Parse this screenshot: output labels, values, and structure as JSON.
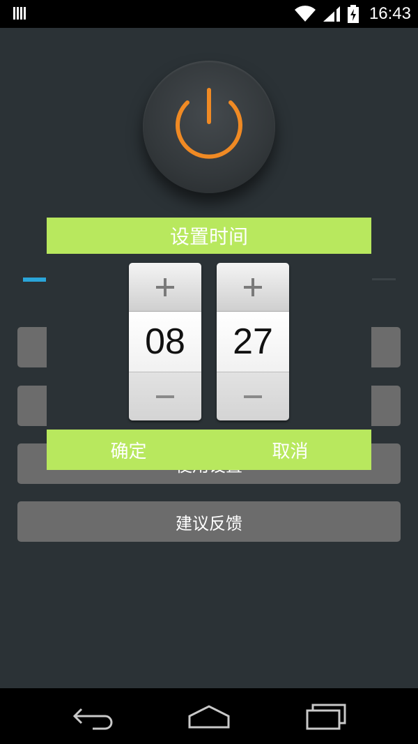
{
  "status_bar": {
    "time": "16:43",
    "icons": [
      "signal-bars-icon",
      "wifi-icon",
      "cellular-icon",
      "battery-charging-icon"
    ]
  },
  "main": {
    "power_button_icon": "power-icon",
    "menu_buttons": [
      "",
      "",
      "使用设置",
      "建议反馈"
    ]
  },
  "dialog": {
    "title": "设置时间",
    "hour": "08",
    "minute": "27",
    "increment_icon": "plus-icon",
    "decrement_icon": "minus-icon",
    "confirm_label": "确定",
    "cancel_label": "取消"
  },
  "nav_bar": {
    "icons": [
      "back-icon",
      "home-icon",
      "recents-icon"
    ]
  },
  "colors": {
    "accent_green": "#b8e85e",
    "power_orange": "#f08a24",
    "tab_blue": "#2aa5d9",
    "background": "#2b3236"
  }
}
